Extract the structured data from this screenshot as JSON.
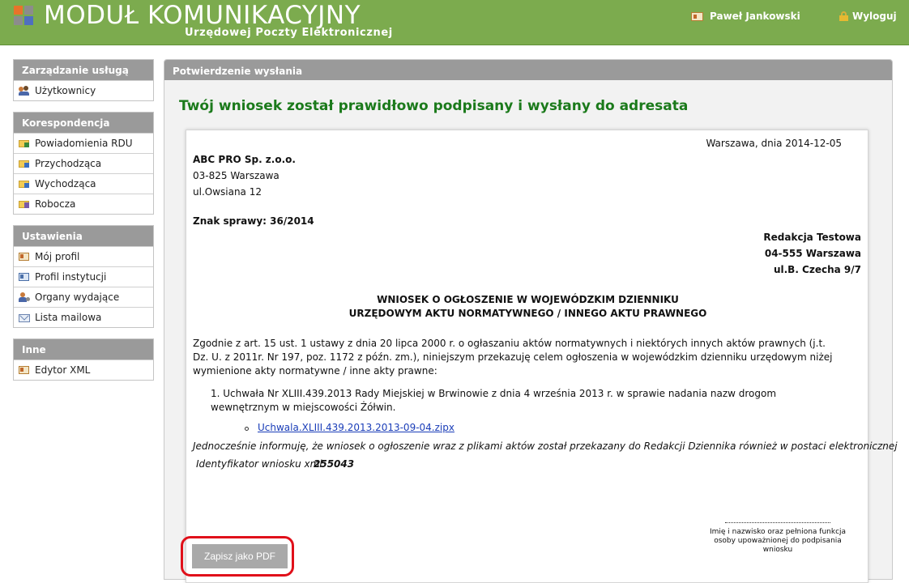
{
  "header": {
    "title": "MODUŁ KOMUNIKACYJNY",
    "subtitle": "Urzędowej Poczty Elektronicznej",
    "user_name": "Paweł Jankowski",
    "logout_label": "Wyloguj"
  },
  "sidebar": {
    "sections": [
      {
        "title": "Zarządzanie usługą",
        "items": [
          "Użytkownicy"
        ]
      },
      {
        "title": "Korespondencja",
        "items": [
          "Powiadomienia RDU",
          "Przychodząca",
          "Wychodząca",
          "Robocza"
        ]
      },
      {
        "title": "Ustawienia",
        "items": [
          "Mój profil",
          "Profil instytucji",
          "Organy wydające",
          "Lista mailowa"
        ]
      },
      {
        "title": "Inne",
        "items": [
          "Edytor XML"
        ]
      }
    ]
  },
  "main": {
    "panel_title": "Potwierdzenie wysłania",
    "success_message": "Twój wniosek został prawidłowo podpisany i wysłany do adresata",
    "save_pdf_label": "Zapisz jako PDF"
  },
  "document": {
    "date_line": "Warszawa, dnia 2014-12-05",
    "sender_name": "ABC PRO Sp. z.o.o.",
    "sender_city": "03-825 Warszawa",
    "sender_street": "ul.Owsiana 12",
    "case_number": "Znak sprawy: 36/2014",
    "recipient_name": "Redakcja Testowa",
    "recipient_city": "04-555 Warszawa",
    "recipient_street": "ul.B. Czecha 9/7",
    "heading_line1": "WNIOSEK O OGŁOSZENIE W WOJEWÓDZKIM DZIENNIKU",
    "heading_line2": "URZĘDOWYM AKTU NORMATYWNEGO / INNEGO AKTU PRAWNEGO",
    "body": "Zgodnie z art. 15 ust. 1 ustawy z dnia 20 lipca 2000 r. o ogłaszaniu aktów normatywnych i niektórych innych aktów prawnych (j.t. Dz. U. z 2011r. Nr 197, poz. 1172 z późn. zm.), niniejszym przekazuję celem ogłoszenia w wojewódzkim dzienniku urzędowym niżej wymienione akty normatywne / inne akty prawne:",
    "list_item": "1.  Uchwała Nr XLIII.439.2013 Rady Miejskiej w Brwinowie z dnia 4 września 2013 r. w sprawie nadania nazw drogom wewnętrznym w miejscowości Żółwin.",
    "attachment": "Uchwala.XLIII.439.2013.2013-09-04.zipx",
    "note": "Jednocześnie informuję, że wniosek o ogłoszenie wraz z plikami aktów został przekazany do Redakcji Dziennika również w postaci elektronicznej",
    "id_label": "Identyfikator wniosku xml:",
    "id_value": "255043",
    "signature_caption": "Imię i nazwisko oraz pełniona funkcja osoby upoważnionej do podpisania wniosku"
  },
  "colors": {
    "header_green": "#7cab4e",
    "success_green": "#1b7a1b",
    "highlight_red": "#e0101a",
    "section_gray": "#9a9a9a"
  }
}
